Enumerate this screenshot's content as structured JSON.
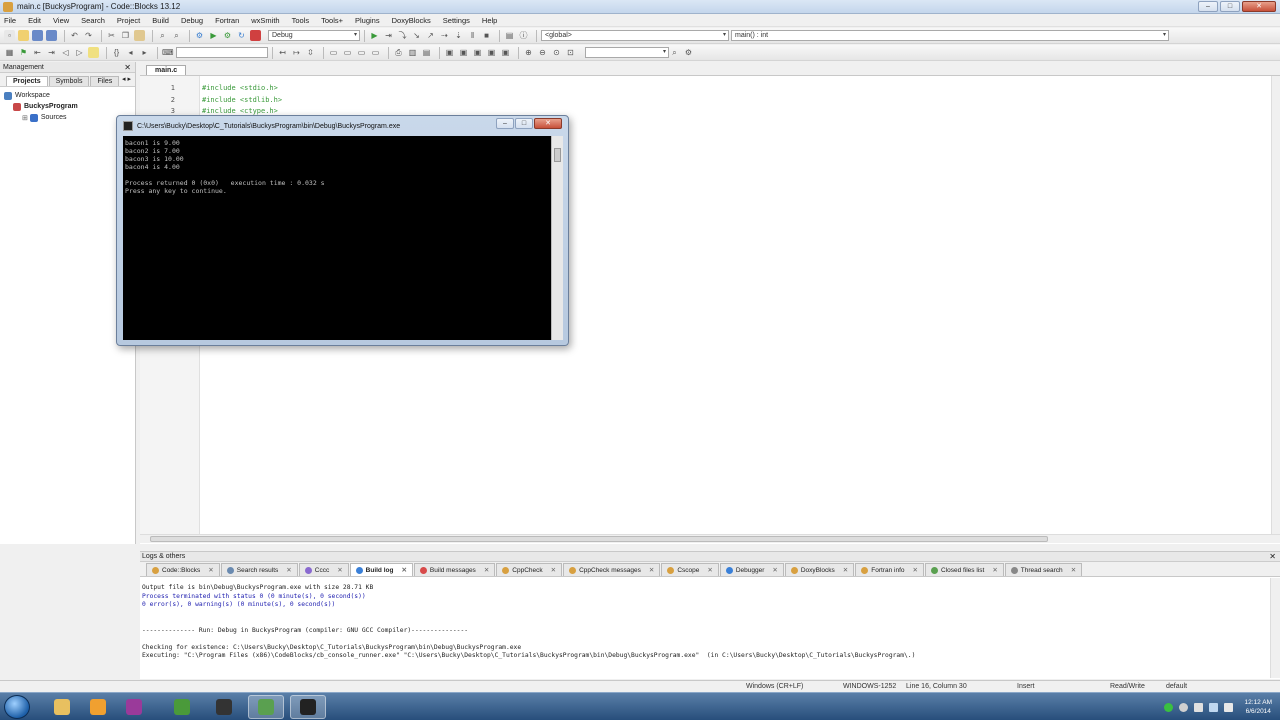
{
  "window": {
    "title": "main.c [BuckysProgram] - Code::Blocks 13.12"
  },
  "menu": [
    "File",
    "Edit",
    "View",
    "Search",
    "Project",
    "Build",
    "Debug",
    "Fortran",
    "wxSmith",
    "Tools",
    "Tools+",
    "Plugins",
    "DoxyBlocks",
    "Settings",
    "Help"
  ],
  "toolbar": {
    "build_target": "Debug",
    "scope": "<global>",
    "symbol": "main() : int"
  },
  "management": {
    "title": "Management",
    "tabs": [
      "Projects",
      "Symbols",
      "Files"
    ],
    "tree": [
      {
        "label": "Workspace",
        "indent": 0,
        "bold": false,
        "color": "#4a7fc0"
      },
      {
        "label": "BuckysProgram",
        "indent": 1,
        "bold": true,
        "color": "#c84848"
      },
      {
        "label": "Sources",
        "indent": 2,
        "bold": false,
        "color": "#3a70c8"
      }
    ]
  },
  "editor": {
    "tab": "main.c",
    "line_numbers": [
      "1",
      "2",
      "3"
    ],
    "lines": [
      "#include <stdio.h>",
      "#include <stdlib.h>",
      "#include <ctype.h>"
    ]
  },
  "console": {
    "title": "C:\\Users\\Bucky\\Desktop\\C_Tutorials\\BuckysProgram\\bin\\Debug\\BuckysProgram.exe",
    "lines": [
      "bacon1 is 9.00",
      "bacon2 is 7.00",
      "bacon3 is 10.00",
      "bacon4 is 4.00",
      "",
      "Process returned 0 (0x0)   execution time : 0.032 s",
      "Press any key to continue."
    ]
  },
  "logs": {
    "title": "Logs & others",
    "tabs": [
      {
        "label": "Code::Blocks",
        "active": false,
        "color": "#d8a040"
      },
      {
        "label": "Search results",
        "active": false,
        "color": "#6a8ab0"
      },
      {
        "label": "Cccc",
        "active": false,
        "color": "#8a6ad0"
      },
      {
        "label": "Build log",
        "active": true,
        "color": "#3a80d8"
      },
      {
        "label": "Build messages",
        "active": false,
        "color": "#d84a4a"
      },
      {
        "label": "CppCheck",
        "active": false,
        "color": "#d8a040"
      },
      {
        "label": "CppCheck messages",
        "active": false,
        "color": "#d8a040"
      },
      {
        "label": "Cscope",
        "active": false,
        "color": "#d8a040"
      },
      {
        "label": "Debugger",
        "active": false,
        "color": "#3a80d8"
      },
      {
        "label": "DoxyBlocks",
        "active": false,
        "color": "#d8a040"
      },
      {
        "label": "Fortran info",
        "active": false,
        "color": "#d8a040"
      },
      {
        "label": "Closed files list",
        "active": false,
        "color": "#5aa050"
      },
      {
        "label": "Thread search",
        "active": false,
        "color": "#888888"
      }
    ],
    "lines": [
      {
        "text": "Output file is bin\\Debug\\BuckysProgram.exe with size 28.71 KB",
        "blue": false
      },
      {
        "text": "Process terminated with status 0 (0 minute(s), 0 second(s))",
        "blue": true
      },
      {
        "text": "0 error(s), 0 warning(s) (0 minute(s), 0 second(s))",
        "blue": true
      },
      {
        "text": "",
        "blue": false
      },
      {
        "text": "",
        "blue": false
      },
      {
        "text": "-------------- Run: Debug in BuckysProgram (compiler: GNU GCC Compiler)---------------",
        "blue": false
      },
      {
        "text": "",
        "blue": false
      },
      {
        "text": "Checking for existence: C:\\Users\\Bucky\\Desktop\\C_Tutorials\\BuckysProgram\\bin\\Debug\\BuckysProgram.exe",
        "blue": false
      },
      {
        "text": "Executing: \"C:\\Program Files (x86)\\CodeBlocks/cb_console_runner.exe\" \"C:\\Users\\Bucky\\Desktop\\C_Tutorials\\BuckysProgram\\bin\\Debug\\BuckysProgram.exe\"  (in C:\\Users\\Bucky\\Desktop\\C_Tutorials\\BuckysProgram\\.)",
        "blue": false
      }
    ]
  },
  "status": {
    "eol": "Windows (CR+LF)",
    "encoding": "WINDOWS-1252",
    "position": "Line 16, Column 30",
    "mode": "Insert",
    "access": "Read/Write",
    "profile": "default"
  },
  "taskbar": {
    "apps": [
      {
        "name": "explorer",
        "color": "#e8c060",
        "active": false
      },
      {
        "name": "media-player",
        "color": "#f0a030",
        "active": false
      },
      {
        "name": "winrar",
        "color": "#9a3a9a",
        "active": false
      },
      {
        "name": "chrome",
        "color": "#4a9a3a",
        "active": false
      },
      {
        "name": "obs",
        "color": "#333333",
        "active": false
      },
      {
        "name": "codeblocks",
        "color": "#5aa050",
        "active": true
      },
      {
        "name": "console",
        "color": "#222222",
        "active": true
      }
    ],
    "time": "12:12 AM",
    "date": "6/6/2014"
  }
}
